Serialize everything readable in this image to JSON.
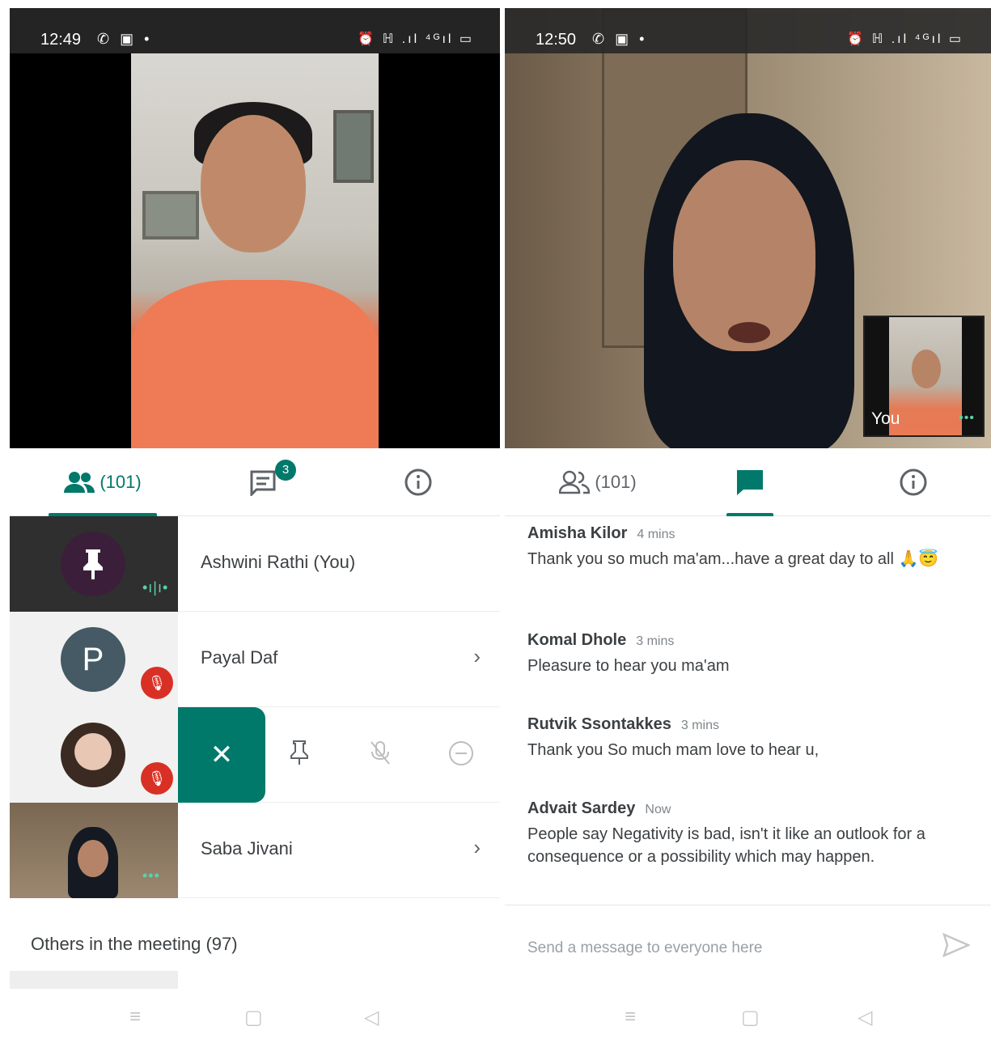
{
  "left": {
    "status": {
      "time": "12:49",
      "left_icons": "✆ ▣ •",
      "right_icons": "⏰ ℍ .ıl ⁴ᴳıl ▭"
    },
    "tabs": {
      "people_count": "(101)",
      "chat_badge": "3"
    },
    "participants": [
      {
        "name": "Ashwini Rathi (You)"
      },
      {
        "name": "Payal Daf",
        "avatar_letter": "P"
      },
      {
        "name": ""
      },
      {
        "name": "Saba Jivani"
      }
    ],
    "action_close": "✕",
    "others_title": "Others in the meeting (97)"
  },
  "right": {
    "status": {
      "time": "12:50",
      "left_icons": "✆ ▣ •",
      "right_icons": "⏰ ℍ .ıl ⁴ᴳıl ▭"
    },
    "pip_label": "You",
    "tabs": {
      "people_count": "(101)"
    },
    "messages": [
      {
        "sender": "Amisha Kilor",
        "ago": "4 mins",
        "text": "Thank you so much ma'am...have a great day to all 🙏😇"
      },
      {
        "sender": "Komal Dhole",
        "ago": "3 mins",
        "text": "Pleasure to hear you ma'am"
      },
      {
        "sender": "Rutvik Ssontakkes",
        "ago": "3 mins",
        "text": "Thank you So much mam love to hear u,"
      },
      {
        "sender": "Advait Sardey",
        "ago": "Now",
        "text": "People say Negativity is bad, isn't  it like an outlook for a consequence or a possibility which may happen."
      }
    ],
    "composer_placeholder": "Send a message to everyone here"
  },
  "colors": {
    "accent": "#00796b",
    "mic_off": "#d93025",
    "speaking": "#5bd1a6",
    "avatar_p": "#455a64"
  },
  "icons": {
    "people": "people-icon",
    "chat": "chat-icon",
    "info": "info-icon",
    "pin": "pin-icon",
    "mute": "mic-off-icon",
    "remove": "remove-icon",
    "send": "send-icon",
    "nav_menu": "menu-icon",
    "nav_home": "home-icon",
    "nav_back": "back-icon"
  }
}
